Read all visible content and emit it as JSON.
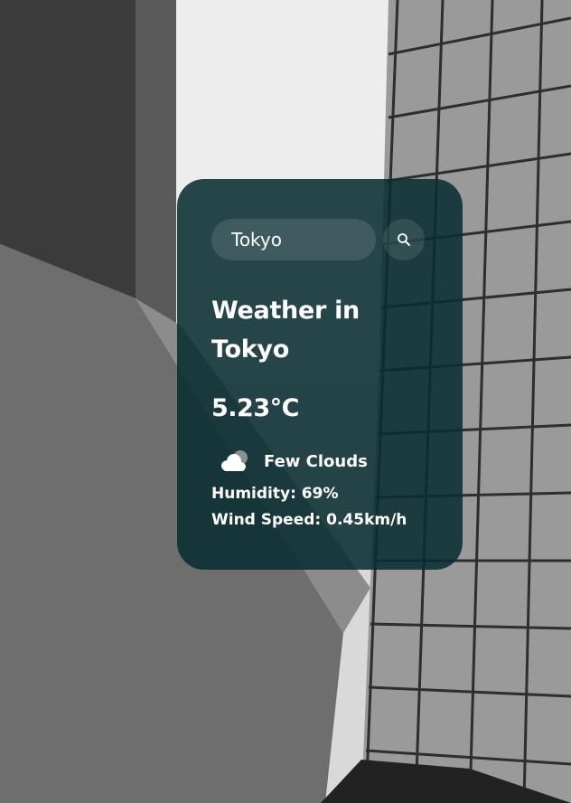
{
  "search": {
    "value": "Tokyo"
  },
  "weather": {
    "title": "Weather in Tokyo",
    "temperature": "5.23°C",
    "condition": "Few Clouds",
    "condition_icon": "cloud-icon",
    "humidity": "Humidity: 69%",
    "wind_speed": "Wind Speed: 0.45km/h"
  },
  "colors": {
    "card_bg": "#0a2d32",
    "text": "#ffffff"
  }
}
